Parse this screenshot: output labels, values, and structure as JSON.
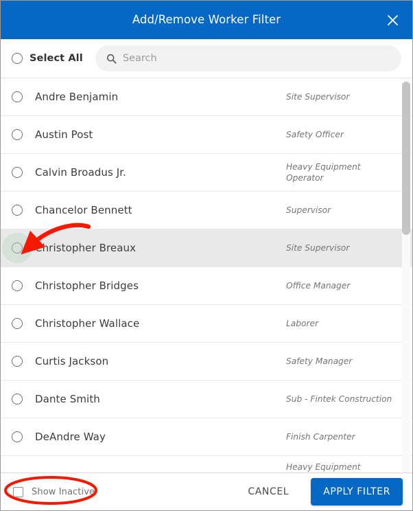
{
  "dialog": {
    "title": "Add/Remove Worker Filter",
    "close_icon": "close-icon",
    "accent_color": "#0568c4",
    "annotation_color": "#f71800"
  },
  "toolbar": {
    "select_all_label": "Select All",
    "select_all_checked": false,
    "search_icon": "search-icon",
    "search_value": "",
    "search_placeholder": "Search"
  },
  "list": {
    "scroll_thumb_position": "top",
    "rows": [
      {
        "name": "Andre Benjamin",
        "role": "Site Supervisor",
        "selected": false,
        "highlighted": false
      },
      {
        "name": "Austin Post",
        "role": "Safety Officer",
        "selected": false,
        "highlighted": false
      },
      {
        "name": "Calvin Broadus Jr.",
        "role": "Heavy Equipment Operator",
        "selected": false,
        "highlighted": false
      },
      {
        "name": "Chancelor Bennett",
        "role": "Supervisor",
        "selected": false,
        "highlighted": false
      },
      {
        "name": "Christopher Breaux",
        "role": "Site Supervisor",
        "selected": false,
        "highlighted": true
      },
      {
        "name": "Christopher Bridges",
        "role": "Office Manager",
        "selected": false,
        "highlighted": false
      },
      {
        "name": "Christopher Wallace",
        "role": "Laborer",
        "selected": false,
        "highlighted": false
      },
      {
        "name": "Curtis Jackson",
        "role": "Safety Manager",
        "selected": false,
        "highlighted": false
      },
      {
        "name": "Dante Smith",
        "role": "Sub - Fintek Construction",
        "selected": false,
        "highlighted": false
      },
      {
        "name": "DeAndre Way",
        "role": "Finish Carpenter",
        "selected": false,
        "highlighted": false
      },
      {
        "name": "",
        "role": "Heavy Equipment",
        "selected": false,
        "highlighted": false
      }
    ]
  },
  "footer": {
    "show_inactive_label": "Show Inactive",
    "show_inactive_checked": false,
    "cancel_label": "CANCEL",
    "apply_label": "APPLY FILTER"
  }
}
